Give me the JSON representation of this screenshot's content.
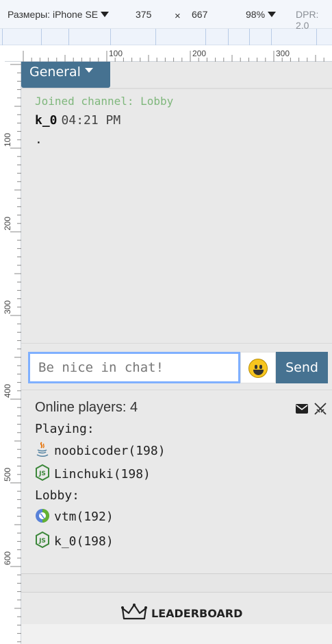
{
  "devtools": {
    "dimensions_label": "Размеры: iPhone SE",
    "width": "375",
    "times": "×",
    "height": "667",
    "zoom": "98%",
    "dpr": "DPR: 2.0"
  },
  "rulers": {
    "top": [
      "100",
      "200",
      "300"
    ],
    "left": [
      "100",
      "200",
      "300",
      "400",
      "500",
      "600"
    ]
  },
  "chat": {
    "channel": "General",
    "messages": {
      "system": "Joined channel: Lobby",
      "user": "k_0",
      "time": "04:21 PM",
      "text": "."
    },
    "input_placeholder": "Be nice in chat!",
    "send_label": "Send"
  },
  "players": {
    "online_label": "Online players: 4",
    "playing_label": "Playing:",
    "lobby_label": "Lobby:",
    "playing": [
      "noobicoder(198)",
      "Linchuki(198)"
    ],
    "lobby": [
      "vtm(192)",
      "k_0(198)"
    ]
  },
  "leaderboard_label": "LEADERBOARD",
  "icons": {
    "java": "java-icon",
    "node": "nodejs-icon",
    "clojure": "clojure-icon",
    "mail": "mail-icon",
    "swords": "swords-icon",
    "crown": "crown-icon",
    "emoji": "smiley-icon"
  },
  "colors": {
    "accent": "#467291",
    "system_message": "#7fb77c",
    "input_focus": "#7fb0ff",
    "panel_bg": "#e9e9e9",
    "node_green": "#3c873a"
  }
}
